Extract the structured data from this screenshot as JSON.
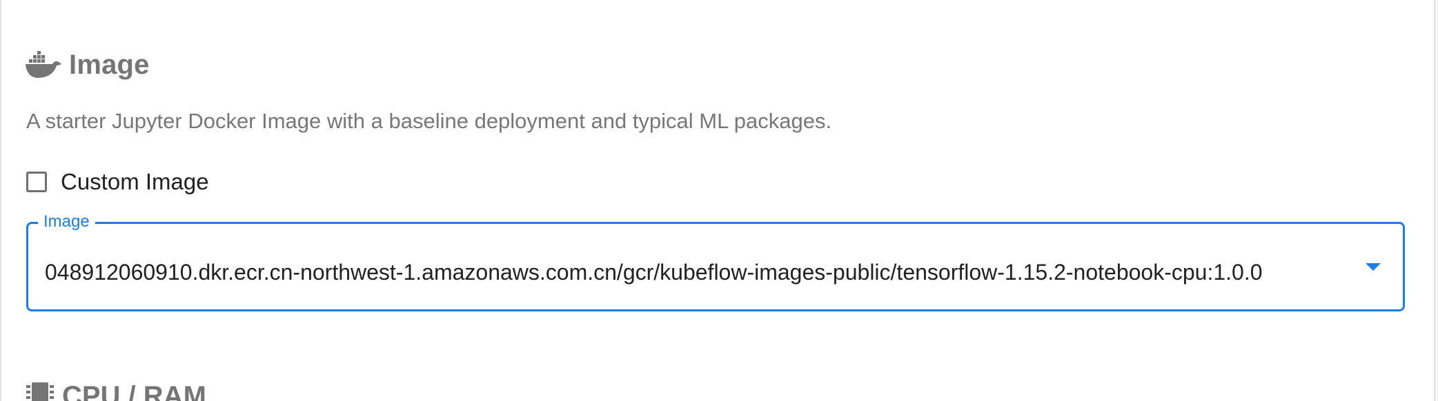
{
  "image_section": {
    "icon": "docker-icon",
    "title": "Image",
    "description": "A starter Jupyter Docker Image with a baseline deployment and typical ML packages.",
    "custom_image": {
      "label": "Custom Image",
      "checked": false
    },
    "image_select": {
      "label": "Image",
      "value": "048912060910.dkr.ecr.cn-northwest-1.amazonaws.com.cn/gcr/kubeflow-images-public/tensorflow-1.15.2-notebook-cpu:1.0.0"
    }
  },
  "cpu_ram_section": {
    "icon": "chip-icon",
    "title": "CPU / RAM"
  },
  "colors": {
    "accent": "#1a7ee6",
    "heading": "#757575",
    "text": "#212121",
    "description": "#777777"
  }
}
